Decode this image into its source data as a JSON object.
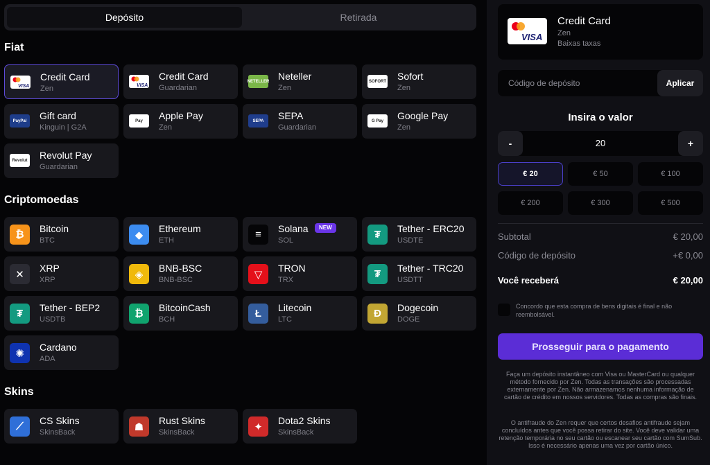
{
  "tabs": {
    "deposit": "Depósito",
    "withdraw": "Retirada"
  },
  "sections": {
    "fiat": "Fiat",
    "crypto": "Criptomoedas",
    "skins": "Skins"
  },
  "fiat": [
    {
      "name": "Credit Card",
      "sub": "Zen",
      "icon": "visa-mastercard-logo",
      "selected": true
    },
    {
      "name": "Credit Card",
      "sub": "Guardarian",
      "icon": "visa-mastercard-logo"
    },
    {
      "name": "Neteller",
      "sub": "Zen",
      "icon": "neteller-logo",
      "logo_text": "NETELLER",
      "bg": "#7ab648"
    },
    {
      "name": "Sofort",
      "sub": "Zen",
      "icon": "sofort-logo",
      "logo_text": "SOFORT",
      "bg": "#ffffff"
    },
    {
      "name": "Gift card",
      "sub": "Kinguin | G2A",
      "icon": "paypal-logo",
      "logo_text": "PayPal",
      "bg": "#1e3d8a"
    },
    {
      "name": "Apple Pay",
      "sub": "Zen",
      "icon": "apple-pay-logo",
      "logo_text": "Pay",
      "bg": "#ffffff"
    },
    {
      "name": "SEPA",
      "sub": "Guardarian",
      "icon": "sepa-logo",
      "logo_text": "SEPA",
      "bg": "#1f3d8c"
    },
    {
      "name": "Google Pay",
      "sub": "Zen",
      "icon": "google-pay-logo",
      "logo_text": "G Pay",
      "bg": "#ffffff"
    },
    {
      "name": "Revolut Pay",
      "sub": "Guardarian",
      "icon": "revolut-logo",
      "logo_text": "Revolut",
      "bg": "#ffffff"
    }
  ],
  "crypto": [
    {
      "name": "Bitcoin",
      "sub": "BTC",
      "icon": "bitcoin-icon",
      "glyph": "₿",
      "bg": "#f7931a"
    },
    {
      "name": "Ethereum",
      "sub": "ETH",
      "icon": "ethereum-icon",
      "glyph": "◆",
      "bg": "#3c8cf0"
    },
    {
      "name": "Solana",
      "sub": "SOL",
      "icon": "solana-icon",
      "glyph": "≡",
      "bg": "#050507",
      "badge": "NEW"
    },
    {
      "name": "Tether - ERC20",
      "sub": "USDTE",
      "icon": "tether-icon",
      "glyph": "₮",
      "bg": "#139a80"
    },
    {
      "name": "XRP",
      "sub": "XRP",
      "icon": "xrp-icon",
      "glyph": "✕",
      "bg": "#2b2b33"
    },
    {
      "name": "BNB-BSC",
      "sub": "BNB-BSC",
      "icon": "bnb-icon",
      "glyph": "◈",
      "bg": "#f0b90b"
    },
    {
      "name": "TRON",
      "sub": "TRX",
      "icon": "tron-icon",
      "glyph": "▽",
      "bg": "#e5101a"
    },
    {
      "name": "Tether - TRC20",
      "sub": "USDTT",
      "icon": "tether-icon",
      "glyph": "₮",
      "bg": "#139a80"
    },
    {
      "name": "Tether - BEP2",
      "sub": "USDTB",
      "icon": "tether-icon",
      "glyph": "₮",
      "bg": "#139a80"
    },
    {
      "name": "BitcoinCash",
      "sub": "BCH",
      "icon": "bitcoincash-icon",
      "glyph": "₿",
      "bg": "#10a36e"
    },
    {
      "name": "Litecoin",
      "sub": "LTC",
      "icon": "litecoin-icon",
      "glyph": "Ł",
      "bg": "#345d9d"
    },
    {
      "name": "Dogecoin",
      "sub": "DOGE",
      "icon": "dogecoin-icon",
      "glyph": "Ð",
      "bg": "#c2a633"
    },
    {
      "name": "Cardano",
      "sub": "ADA",
      "icon": "cardano-icon",
      "glyph": "✺",
      "bg": "#0f33b0"
    }
  ],
  "skins": [
    {
      "name": "CS Skins",
      "sub": "SkinsBack",
      "icon": "cs-skins-icon",
      "glyph": "⟋",
      "bg": "#2f6fd8"
    },
    {
      "name": "Rust Skins",
      "sub": "SkinsBack",
      "icon": "rust-skins-icon",
      "glyph": "☗",
      "bg": "#c0392b"
    },
    {
      "name": "Dota2 Skins",
      "sub": "SkinsBack",
      "icon": "dota2-skins-icon",
      "glyph": "✦",
      "bg": "#d02a2a"
    }
  ],
  "selected_method": {
    "title": "Credit Card",
    "provider": "Zen",
    "note": "Baixas taxas",
    "logo_text": "VISA"
  },
  "deposit_code": {
    "placeholder": "Código de depósito",
    "apply_label": "Aplicar"
  },
  "amount": {
    "title": "Insira o valor",
    "minus": "-",
    "plus": "+",
    "value": "20"
  },
  "presets": [
    "€ 20",
    "€ 50",
    "€ 100",
    "€ 200",
    "€ 300",
    "€ 500"
  ],
  "summary": {
    "subtotal_label": "Subtotal",
    "subtotal_value": "€ 20,00",
    "code_label": "Código de depósito",
    "code_value": "+€ 0,00",
    "receive_label": "Você receberá",
    "receive_value": "€ 20,00"
  },
  "agree_text": "Concordo que esta compra de bens digitais é final e não reembolsável.",
  "proceed_label": "Prosseguir para o pagamento",
  "info1": "Faça um depósito instantâneo com Visa ou MasterCard ou qualquer método fornecido por Zen. Todas as transações são processadas externamente por Zen. Não armazenamos nenhuma informação de cartão de crédito em nossos servidores. Todas as compras são finais.",
  "info2": "O antifraude do Zen requer que certos desafios antifraude sejam concluídos antes que você possa retirar do site. Você deve validar uma retenção temporária no seu cartão ou escanear seu cartão com SumSub. Isso é necessário apenas uma vez por cartão único.",
  "colors": {
    "accent": "#5b2dd6",
    "selected_border": "#5e4bd8",
    "panel": "#101015",
    "card": "#18181d"
  }
}
